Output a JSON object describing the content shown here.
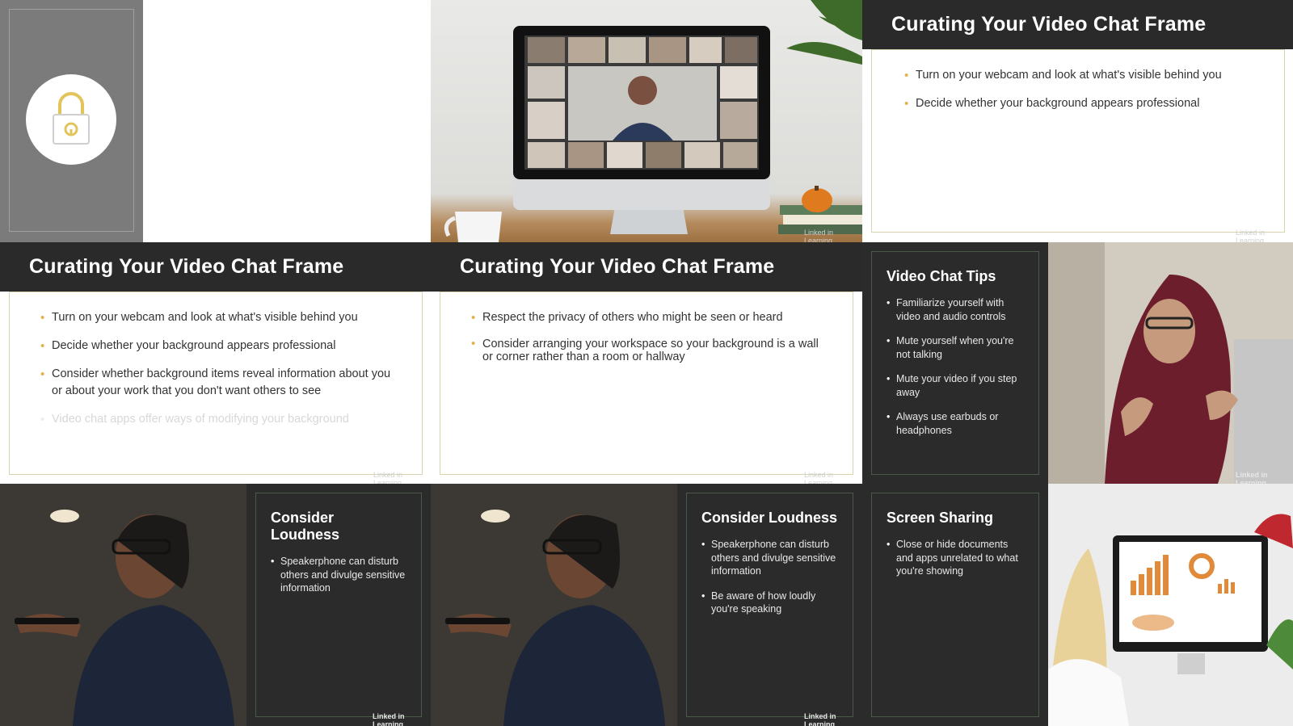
{
  "slides": {
    "top_right": {
      "title": "Curating Your Video Chat Frame",
      "bullets": [
        "Turn on your webcam and look at what's visible behind you",
        "Decide whether your background appears professional"
      ]
    },
    "mid_left": {
      "title": "Curating Your Video Chat Frame",
      "bullets": [
        "Turn on your webcam and look at what's visible behind you",
        "Decide whether your background appears professional",
        "Consider whether background items reveal information about you or about your work that you don't want others to see"
      ],
      "faded_bullet": "Video chat apps offer ways of modifying your background"
    },
    "mid_center": {
      "title": "Curating Your Video Chat Frame",
      "bullets": [
        "Respect the privacy of others who might be seen or heard",
        "Consider arranging your workspace so your background is a wall or corner rather than a room or hallway"
      ]
    }
  },
  "cards": {
    "tips": {
      "title": "Video Chat Tips",
      "bullets": [
        "Familiarize yourself with video and audio controls",
        "Mute yourself when you're not talking",
        "Mute your video if you step away",
        "Always use earbuds or headphones"
      ]
    },
    "loudness_1": {
      "title": "Consider Loudness",
      "bullets": [
        "Speakerphone can disturb others and divulge sensitive information"
      ]
    },
    "loudness_2": {
      "title": "Consider Loudness",
      "bullets": [
        "Speakerphone can disturb others and divulge sensitive information",
        "Be aware of how loudly you're speaking"
      ]
    },
    "screen_sharing": {
      "title": "Screen Sharing",
      "bullets": [
        "Close or hide documents and apps unrelated to what you're showing"
      ]
    }
  },
  "watermark": "Linked in Learning",
  "colors": {
    "bullet_accent": "#e0b24a",
    "header_dark": "#2a2a2a",
    "lock_gold": "#e3c45a"
  }
}
